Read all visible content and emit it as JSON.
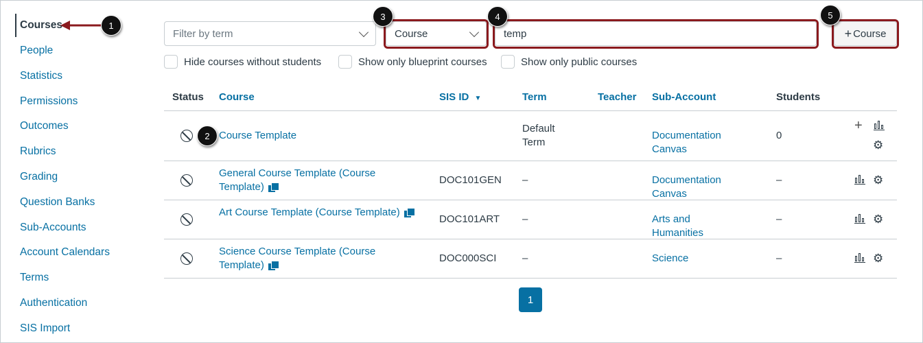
{
  "sidebar": {
    "items": [
      "Courses",
      "People",
      "Statistics",
      "Permissions",
      "Outcomes",
      "Rubrics",
      "Grading",
      "Question Banks",
      "Sub-Accounts",
      "Account Calendars",
      "Terms",
      "Authentication",
      "SIS Import"
    ]
  },
  "filters": {
    "term_placeholder": "Filter by term",
    "search_by": "Course",
    "search_value": "temp",
    "add_course": "Course",
    "checkboxes": [
      "Hide courses without students",
      "Show only blueprint courses",
      "Show only public courses"
    ]
  },
  "table": {
    "headers": [
      "Status",
      "Course",
      "SIS ID",
      "Term",
      "Teacher",
      "Sub-Account",
      "Students"
    ],
    "sort_indicator": "▼",
    "rows": [
      {
        "course": "Course Template",
        "sis": "",
        "term": "Default Term",
        "teacher": "",
        "sub": "Documentation Canvas",
        "students": "0"
      },
      {
        "course": "General Course Template (Course Template)",
        "sis": "DOC101GEN",
        "term": "–",
        "teacher": "",
        "sub": "Documentation Canvas",
        "students": "–"
      },
      {
        "course": "Art Course Template (Course Template)",
        "sis": "DOC101ART",
        "term": "–",
        "teacher": "",
        "sub": "Arts and Humanities",
        "students": "–"
      },
      {
        "course": "Science Course Template (Course Template)",
        "sis": "DOC000SCI",
        "term": "–",
        "teacher": "",
        "sub": "Science",
        "students": "–"
      }
    ]
  },
  "pagination": {
    "current": "1"
  },
  "annotations": [
    "1",
    "2",
    "3",
    "4",
    "5"
  ]
}
